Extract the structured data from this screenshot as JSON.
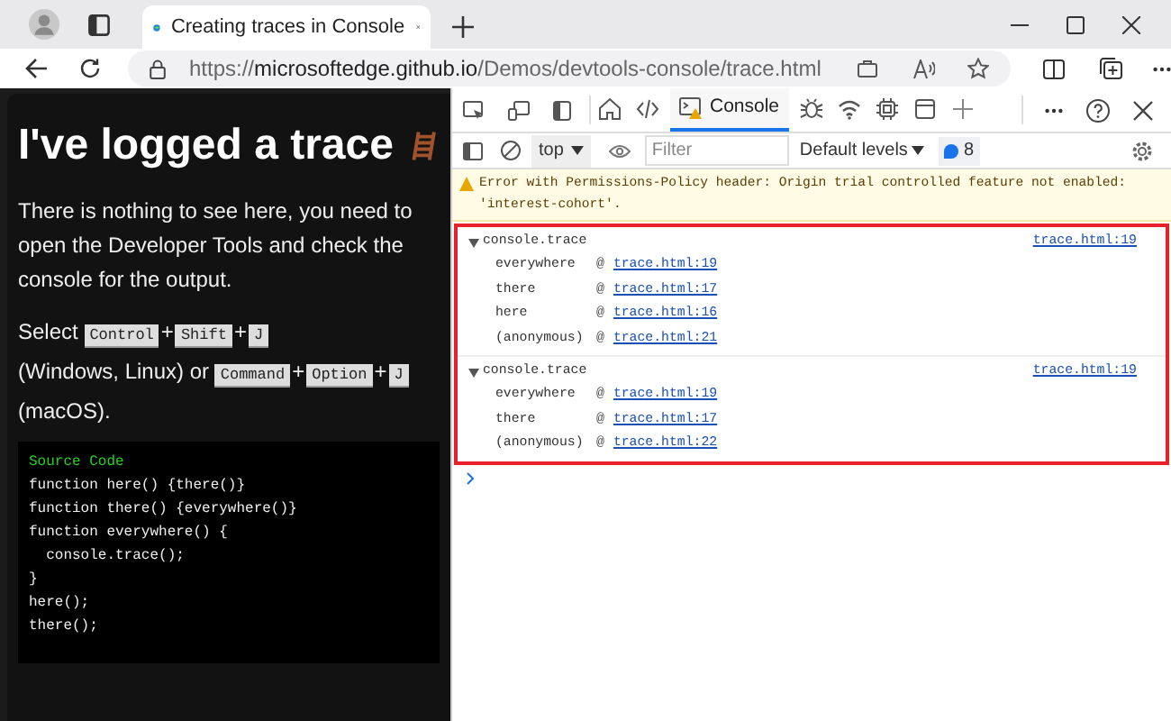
{
  "browser": {
    "tab_title": "Creating traces in Console",
    "url": {
      "scheme": "https://",
      "host": "microsoftedge.github.io",
      "path": "/Demos/devtools-console/trace.html"
    }
  },
  "page": {
    "heading": "I've logged a trace",
    "intro": "There is nothing to see here, you need to open the Developer Tools and check the console for the output.",
    "shortcut": [
      {
        "kind": "text",
        "text": "Select"
      },
      {
        "kind": "key",
        "text": "Control"
      },
      {
        "kind": "plus",
        "text": "+"
      },
      {
        "kind": "key",
        "text": "Shift"
      },
      {
        "kind": "plus",
        "text": "+"
      },
      {
        "kind": "key",
        "text": "J"
      },
      {
        "kind": "text",
        "text": "(Windows, Linux) or"
      },
      {
        "kind": "key",
        "text": "Command"
      },
      {
        "kind": "plus",
        "text": "+"
      },
      {
        "kind": "key",
        "text": "Option"
      },
      {
        "kind": "plus",
        "text": "+"
      },
      {
        "kind": "key",
        "text": "J"
      },
      {
        "kind": "text",
        "text": "(macOS)."
      }
    ],
    "code": {
      "title": "Source Code",
      "lines": [
        "function here() {there()}",
        "function there() {everywhere()}",
        "function everywhere() {",
        "  console.trace();",
        "}",
        "here();",
        "there();"
      ]
    }
  },
  "devtools": {
    "tabs": [
      {
        "kind": "home",
        "selected": false
      },
      {
        "kind": "elements",
        "selected": false
      },
      {
        "kind": "console",
        "label": "Console",
        "selected": true
      },
      {
        "kind": "bug",
        "selected": false
      },
      {
        "kind": "wifi",
        "selected": false
      },
      {
        "kind": "chip",
        "selected": false
      },
      {
        "kind": "window",
        "selected": false
      },
      {
        "kind": "add",
        "selected": false
      }
    ],
    "context": "top",
    "filter": {
      "placeholder": "Filter"
    },
    "levels": "Default levels",
    "issues_count": "8",
    "warning": "Error with Permissions-Policy header: Origin trial controlled feature not enabled: 'interest-cohort'.",
    "frame_separator": "@",
    "traces": [
      {
        "title": "console.trace",
        "expanded": true,
        "source": "trace.html:19",
        "frames": [
          {
            "fn": "everywhere",
            "link": "trace.html:19"
          },
          {
            "fn": "there",
            "link": "trace.html:17"
          },
          {
            "fn": "here",
            "link": "trace.html:16"
          },
          {
            "fn": "(anonymous)",
            "link": "trace.html:21"
          }
        ]
      },
      {
        "title": "console.trace",
        "expanded": true,
        "source": "trace.html:19",
        "frames": [
          {
            "fn": "everywhere",
            "link": "trace.html:19"
          },
          {
            "fn": "there",
            "link": "trace.html:17"
          },
          {
            "fn": "(anonymous)",
            "link": "trace.html:22"
          }
        ]
      }
    ]
  }
}
